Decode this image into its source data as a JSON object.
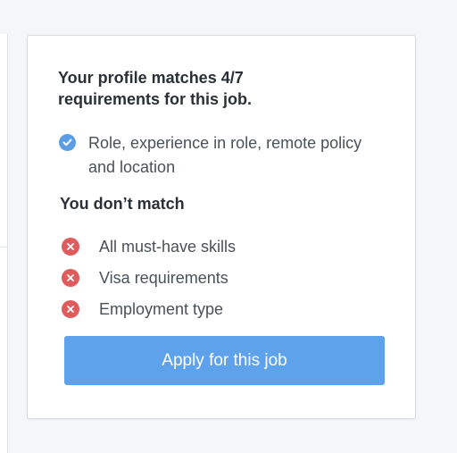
{
  "card": {
    "headline": "Your profile matches 4/7 requirements for this job.",
    "matched_text": "Role, experience in role, remote policy and location",
    "mismatch_heading": "You don’t match",
    "mismatches": [
      {
        "label": "All must-have skills",
        "icon": "x-circle-icon"
      },
      {
        "label": "Visa requirements",
        "icon": "x-circle-icon"
      },
      {
        "label": "Employment type",
        "icon": "x-circle-icon"
      }
    ],
    "match_icon": "check-circle-icon",
    "apply_label": "Apply for this job"
  },
  "colors": {
    "accent": "#5ea2ec",
    "check": "#5b9ee6",
    "mismatch": "#e05c5c",
    "heading_text": "#2b3036",
    "body_text": "#4b5158",
    "background": "#f5f6f8"
  }
}
